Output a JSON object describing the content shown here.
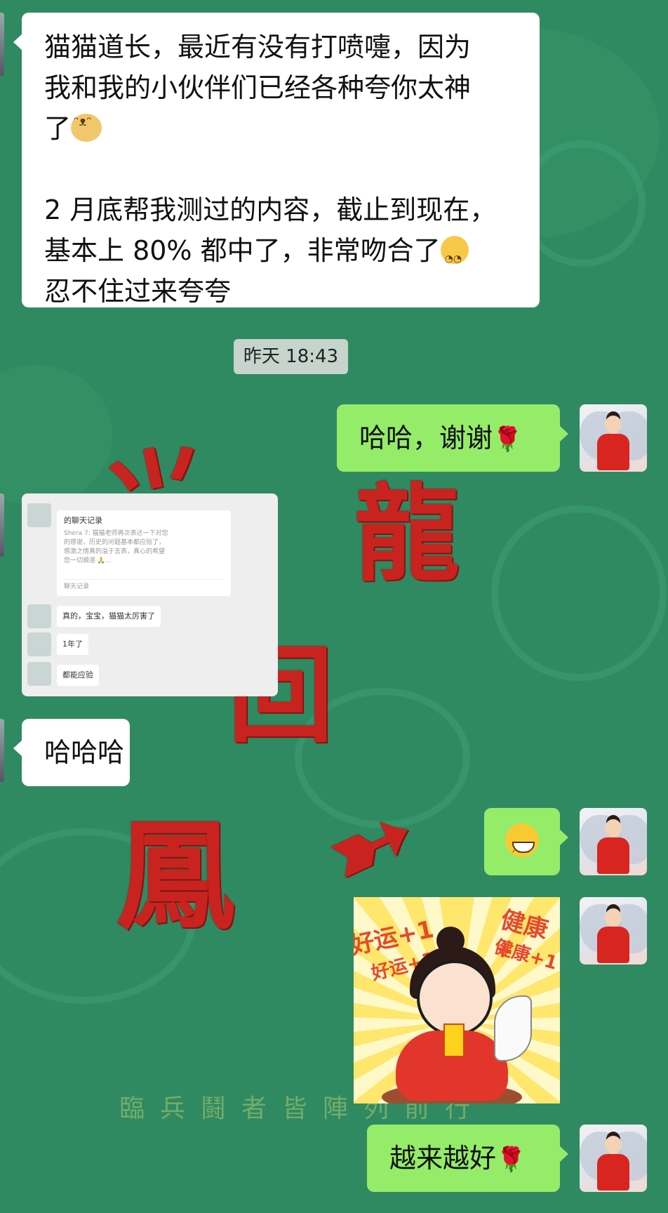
{
  "messages": [
    {
      "id": "m1",
      "side": "incoming",
      "lines": [
        "猫猫道长，最近有没有打喷嚏，因为",
        "我和我的小伙伴们已经各种夸你太神",
        "了",
        "",
        "2 月底帮我测过的内容，截止到现在，",
        "基本上 80% 都中了，非常吻合了",
        "忍不住过来夸夸"
      ],
      "emojis": [
        "dog-face",
        "thinking-face"
      ]
    },
    {
      "id": "m2",
      "side": "outgoing",
      "text": "哈哈，谢谢",
      "emoji": "rose"
    },
    {
      "id": "m4",
      "side": "incoming",
      "text": "哈哈哈"
    },
    {
      "id": "m5",
      "side": "outgoing",
      "emoji": "grinning-face"
    },
    {
      "id": "m6",
      "side": "outgoing",
      "type": "sticker",
      "texts": [
        "好运+1",
        "健康+",
        "好运+1",
        "健康+1"
      ]
    },
    {
      "id": "m7",
      "side": "outgoing",
      "text": "越来越好",
      "emoji": "rose"
    }
  ],
  "timestamp": "昨天 18:43",
  "quoted_chat": {
    "card_title": "的聊天记录",
    "card_lines": [
      "Shera 7: 猫猫老师再次表达一下对您",
      "的感谢，历史的问题基本都应验了，",
      "感激之情真的溢于言表，真心的希望",
      "您一切顺遂 🙏..."
    ],
    "card_footer": "聊天记录",
    "replies": [
      "真的，宝宝，猫猫太厉害了",
      "1年了",
      "都能应验"
    ]
  },
  "background": {
    "motto": "臨兵鬪者皆陣列前行"
  },
  "colors": {
    "background": "#2f8a62",
    "incoming_bubble": "#ffffff",
    "outgoing_bubble": "#95ec69",
    "glyph_red": "#c9231f"
  }
}
